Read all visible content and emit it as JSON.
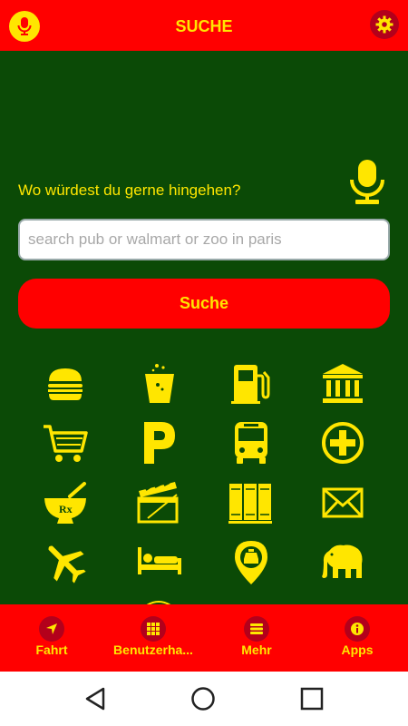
{
  "header": {
    "title": "SUCHE",
    "mic_icon": "microphone-icon",
    "settings_icon": "gear-icon"
  },
  "search": {
    "prompt": "Wo würdest du gerne hingehen?",
    "placeholder": "search pub or walmart or zoo in paris",
    "value": "",
    "button_label": "Suche",
    "voice_icon": "microphone-icon"
  },
  "categories": [
    "burger-icon",
    "drink-icon",
    "fuel-icon",
    "bank-icon",
    "shopping-cart-icon",
    "parking-icon",
    "bus-icon",
    "hospital-plus-icon",
    "pharmacy-icon",
    "cinema-clapper-icon",
    "library-books-icon",
    "mail-icon",
    "airplane-icon",
    "hotel-bed-icon",
    "taxi-location-icon",
    "elephant-zoo-icon"
  ],
  "bottom_nav": {
    "items": [
      {
        "label": "Fahrt",
        "icon": "navigation-arrow-icon"
      },
      {
        "label": "Benutzerha...",
        "icon": "grid-dots-icon"
      },
      {
        "label": "Mehr",
        "icon": "menu-lines-icon"
      },
      {
        "label": "Apps",
        "icon": "info-icon"
      }
    ]
  },
  "system_nav": {
    "icons": [
      "back-icon",
      "home-icon",
      "recents-icon"
    ]
  },
  "colors": {
    "background": "#0b4a06",
    "bar": "#ff0000",
    "accent": "#ffe600",
    "dark_red": "#b3001b"
  }
}
